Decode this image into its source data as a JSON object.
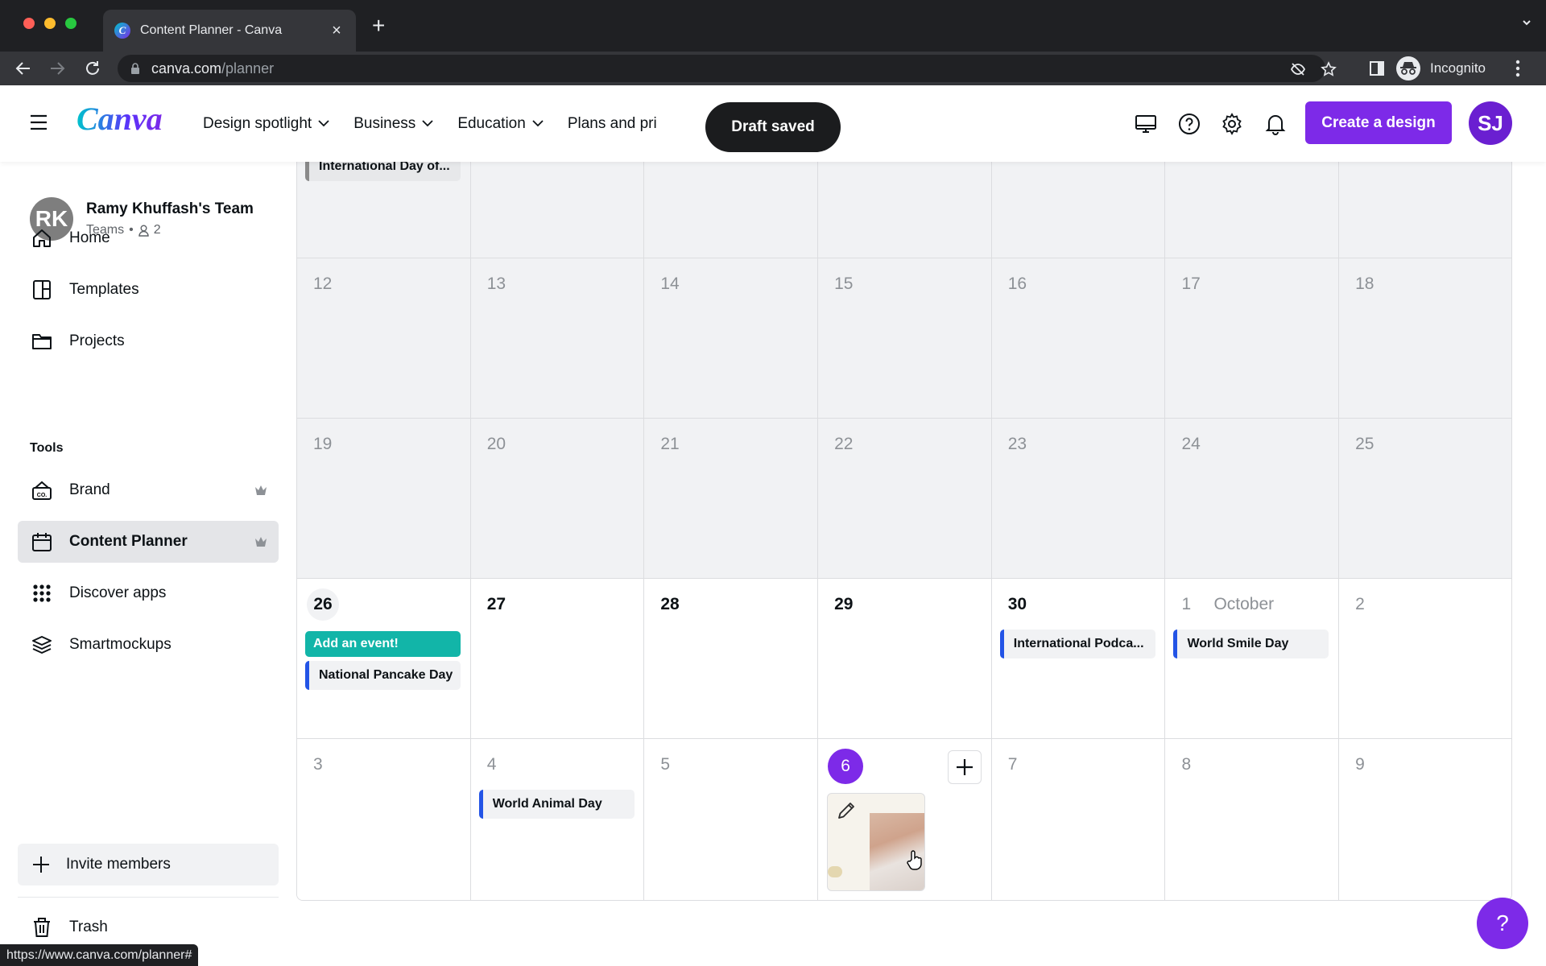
{
  "browser": {
    "tab_title": "Content Planner - Canva",
    "url_domain": "canva.com",
    "url_path": "/planner",
    "profile_label": "Incognito",
    "status_url": "https://www.canva.com/planner#"
  },
  "header": {
    "logo": "Canva",
    "nav": [
      {
        "label": "Design spotlight"
      },
      {
        "label": "Business"
      },
      {
        "label": "Education"
      },
      {
        "label": "Plans and pri"
      }
    ],
    "toast": "Draft saved",
    "create_button": "Create a design",
    "user_initials": "SJ",
    "brand_color": "#7d2ae8"
  },
  "sidebar": {
    "team": {
      "initials": "RK",
      "name": "Ramy Khuffash's Team",
      "plan": "Teams",
      "bullet": "•",
      "members": "2"
    },
    "items": [
      {
        "label": "Home",
        "icon": "home-icon"
      },
      {
        "label": "Templates",
        "icon": "templates-icon"
      },
      {
        "label": "Projects",
        "icon": "folder-icon"
      }
    ],
    "tools_label": "Tools",
    "tools": [
      {
        "label": "Brand",
        "icon": "brand-icon",
        "premium": true
      },
      {
        "label": "Content Planner",
        "icon": "calendar-icon",
        "premium": true,
        "active": true
      },
      {
        "label": "Discover apps",
        "icon": "apps-grid-icon"
      },
      {
        "label": "Smartmockups",
        "icon": "layers-icon"
      }
    ],
    "invite_label": "Invite members",
    "trash_label": "Trash"
  },
  "calendar": {
    "top_partial_event": "International Day of...",
    "weeks": [
      {
        "days": [
          {
            "n": "12"
          },
          {
            "n": "13"
          },
          {
            "n": "14"
          },
          {
            "n": "15"
          },
          {
            "n": "16"
          },
          {
            "n": "17"
          },
          {
            "n": "18"
          }
        ]
      },
      {
        "days": [
          {
            "n": "19"
          },
          {
            "n": "20"
          },
          {
            "n": "21"
          },
          {
            "n": "22"
          },
          {
            "n": "23"
          },
          {
            "n": "24"
          },
          {
            "n": "25"
          }
        ]
      },
      {
        "days": [
          {
            "n": "26",
            "add_event": "Add an event!",
            "events": [
              "National Pancake Day"
            ]
          },
          {
            "n": "27"
          },
          {
            "n": "28"
          },
          {
            "n": "29"
          },
          {
            "n": "30",
            "events": [
              "International Podca..."
            ]
          },
          {
            "n": "1",
            "month": "October",
            "events": [
              "World Smile Day"
            ]
          },
          {
            "n": "2"
          }
        ]
      },
      {
        "days": [
          {
            "n": "3"
          },
          {
            "n": "4",
            "events": [
              "World Animal Day"
            ]
          },
          {
            "n": "5"
          },
          {
            "n": "6",
            "today": true
          },
          {
            "n": "7"
          },
          {
            "n": "8"
          },
          {
            "n": "9"
          }
        ]
      }
    ]
  },
  "help_fab": "?"
}
